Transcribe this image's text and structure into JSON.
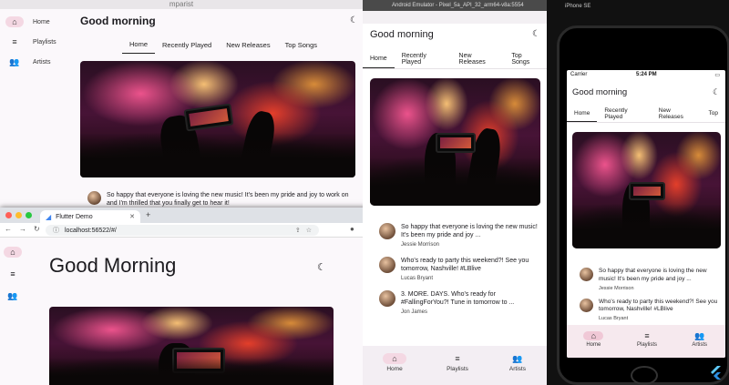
{
  "mac": {
    "window_title": "mparist",
    "greeting": "Good morning",
    "rail": [
      {
        "label": "Home",
        "icon": "home-icon"
      },
      {
        "label": "Playlists",
        "icon": "playlist-icon"
      },
      {
        "label": "Artists",
        "icon": "people-icon"
      }
    ],
    "tabs": [
      "Home",
      "Recently Played",
      "New Releases",
      "Top Songs"
    ],
    "post": {
      "text": "So happy that everyone is loving the new music! It's been my pride and joy to work on and I'm thrilled that you finally get to hear it!"
    }
  },
  "chrome": {
    "tab_title": "Flutter Demo",
    "url": "localhost:56522/#/",
    "greeting": "Good Morning"
  },
  "android": {
    "title_bar": "Android Emulator - Pixel_5a_API_32_arm64-v8a:5554",
    "greeting": "Good morning",
    "tabs": [
      "Home",
      "Recently Played",
      "New Releases",
      "Top Songs"
    ],
    "posts": [
      {
        "text": "So happy that everyone is loving the new music! It's been my pride and joy ...",
        "name": "Jessie Morrison"
      },
      {
        "text": "Who's ready to party this weekend?! See you tomorrow, Nashville! #LBlive",
        "name": "Lucas Bryant"
      },
      {
        "text": "3. MORE. DAYS. Who's ready for #FallingForYou?! Tune in tomorrow to ...",
        "name": "Jon James"
      }
    ],
    "nav": [
      "Home",
      "Playlists",
      "Artists"
    ]
  },
  "ios": {
    "simulator_title": "iPhone SE",
    "carrier": "Carrier",
    "time": "5:24 PM",
    "greeting": "Good morning",
    "tabs": [
      "Home",
      "Recently Played",
      "New Releases",
      "Top"
    ],
    "posts": [
      {
        "text": "So happy that everyone is loving the new music! It's been my pride and joy ...",
        "name": "Jessie Morrison"
      },
      {
        "text": "Who's ready to party this weekend?! See you tomorrow, Nashville! #LBlive",
        "name": "Lucas Bryant"
      }
    ],
    "nav": [
      "Home",
      "Playlists",
      "Artists"
    ]
  },
  "colors": {
    "accent_pill": "#f4d8e3",
    "nav_bg": "#f6e9ee"
  }
}
